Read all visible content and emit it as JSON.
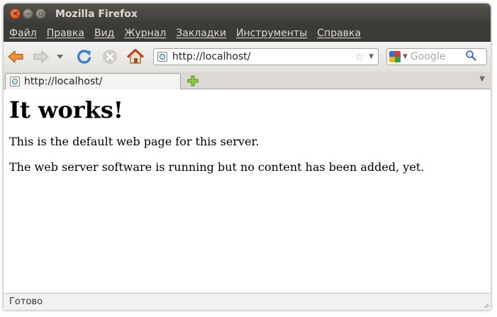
{
  "window": {
    "title": "Mozilla Firefox"
  },
  "menu": {
    "items": [
      "Файл",
      "Правка",
      "Вид",
      "Журнал",
      "Закладки",
      "Инструменты",
      "Справка"
    ]
  },
  "toolbar": {
    "icons": [
      "back-arrow-icon",
      "forward-arrow-icon",
      "history-dropdown-icon",
      "reload-icon",
      "stop-icon",
      "home-icon"
    ],
    "url": "http://localhost/",
    "search_placeholder": "Google"
  },
  "tabs": [
    {
      "label": "http://localhost/",
      "active": true
    }
  ],
  "page": {
    "heading": "It works!",
    "paragraphs": [
      "This is the default web page for this server.",
      "The web server software is running but no content has been added, yet."
    ]
  },
  "status": {
    "text": "Готово"
  },
  "colors": {
    "titlebar": "#3c3b37",
    "close_button": "#df4a16",
    "back_arrow": "#e0823a",
    "reload": "#3f7fcf",
    "home_roof": "#c83a24"
  }
}
